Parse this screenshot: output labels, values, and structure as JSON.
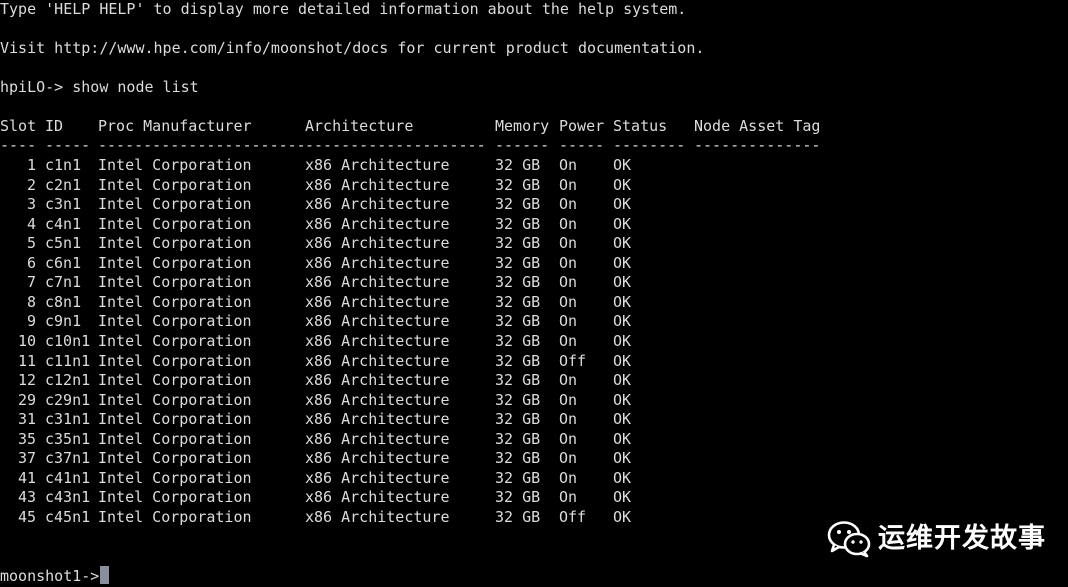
{
  "colors": {
    "background": "#000000",
    "text": "#dcdcdc",
    "cursor": "#8a9099",
    "watermark": "#ffffff"
  },
  "terminal": {
    "help_line": "Type 'HELP HELP' to display more detailed information about the help system.",
    "visit_line": "Visit http://www.hpe.com/info/moonshot/docs for current product documentation.",
    "command_prompt": "hpiLO-> ",
    "command": "show node list",
    "table": {
      "headers": {
        "slot": "Slot",
        "id": "ID",
        "manufacturer": "Proc Manufacturer",
        "architecture": "Architecture",
        "memory": "Memory",
        "power": "Power",
        "status": "Status",
        "asset_tag": "Node Asset Tag"
      },
      "separators": {
        "slot": "----",
        "id": "-----",
        "manufacturer": "-----------------------",
        "architecture": "--------------------",
        "memory": "------",
        "power": "-----",
        "status": "--------",
        "asset_tag": "--------------"
      },
      "rows": [
        {
          "slot": "1",
          "id": "c1n1",
          "manufacturer": "Intel Corporation",
          "architecture": "x86 Architecture",
          "memory": "32 GB",
          "power": "On",
          "status": "OK",
          "asset_tag": ""
        },
        {
          "slot": "2",
          "id": "c2n1",
          "manufacturer": "Intel Corporation",
          "architecture": "x86 Architecture",
          "memory": "32 GB",
          "power": "On",
          "status": "OK",
          "asset_tag": ""
        },
        {
          "slot": "3",
          "id": "c3n1",
          "manufacturer": "Intel Corporation",
          "architecture": "x86 Architecture",
          "memory": "32 GB",
          "power": "On",
          "status": "OK",
          "asset_tag": ""
        },
        {
          "slot": "4",
          "id": "c4n1",
          "manufacturer": "Intel Corporation",
          "architecture": "x86 Architecture",
          "memory": "32 GB",
          "power": "On",
          "status": "OK",
          "asset_tag": ""
        },
        {
          "slot": "5",
          "id": "c5n1",
          "manufacturer": "Intel Corporation",
          "architecture": "x86 Architecture",
          "memory": "32 GB",
          "power": "On",
          "status": "OK",
          "asset_tag": ""
        },
        {
          "slot": "6",
          "id": "c6n1",
          "manufacturer": "Intel Corporation",
          "architecture": "x86 Architecture",
          "memory": "32 GB",
          "power": "On",
          "status": "OK",
          "asset_tag": ""
        },
        {
          "slot": "7",
          "id": "c7n1",
          "manufacturer": "Intel Corporation",
          "architecture": "x86 Architecture",
          "memory": "32 GB",
          "power": "On",
          "status": "OK",
          "asset_tag": ""
        },
        {
          "slot": "8",
          "id": "c8n1",
          "manufacturer": "Intel Corporation",
          "architecture": "x86 Architecture",
          "memory": "32 GB",
          "power": "On",
          "status": "OK",
          "asset_tag": ""
        },
        {
          "slot": "9",
          "id": "c9n1",
          "manufacturer": "Intel Corporation",
          "architecture": "x86 Architecture",
          "memory": "32 GB",
          "power": "On",
          "status": "OK",
          "asset_tag": ""
        },
        {
          "slot": "10",
          "id": "c10n1",
          "manufacturer": "Intel Corporation",
          "architecture": "x86 Architecture",
          "memory": "32 GB",
          "power": "On",
          "status": "OK",
          "asset_tag": ""
        },
        {
          "slot": "11",
          "id": "c11n1",
          "manufacturer": "Intel Corporation",
          "architecture": "x86 Architecture",
          "memory": "32 GB",
          "power": "Off",
          "status": "OK",
          "asset_tag": ""
        },
        {
          "slot": "12",
          "id": "c12n1",
          "manufacturer": "Intel Corporation",
          "architecture": "x86 Architecture",
          "memory": "32 GB",
          "power": "On",
          "status": "OK",
          "asset_tag": ""
        },
        {
          "slot": "29",
          "id": "c29n1",
          "manufacturer": "Intel Corporation",
          "architecture": "x86 Architecture",
          "memory": "32 GB",
          "power": "On",
          "status": "OK",
          "asset_tag": ""
        },
        {
          "slot": "31",
          "id": "c31n1",
          "manufacturer": "Intel Corporation",
          "architecture": "x86 Architecture",
          "memory": "32 GB",
          "power": "On",
          "status": "OK",
          "asset_tag": ""
        },
        {
          "slot": "35",
          "id": "c35n1",
          "manufacturer": "Intel Corporation",
          "architecture": "x86 Architecture",
          "memory": "32 GB",
          "power": "On",
          "status": "OK",
          "asset_tag": ""
        },
        {
          "slot": "37",
          "id": "c37n1",
          "manufacturer": "Intel Corporation",
          "architecture": "x86 Architecture",
          "memory": "32 GB",
          "power": "On",
          "status": "OK",
          "asset_tag": ""
        },
        {
          "slot": "41",
          "id": "c41n1",
          "manufacturer": "Intel Corporation",
          "architecture": "x86 Architecture",
          "memory": "32 GB",
          "power": "On",
          "status": "OK",
          "asset_tag": ""
        },
        {
          "slot": "43",
          "id": "c43n1",
          "manufacturer": "Intel Corporation",
          "architecture": "x86 Architecture",
          "memory": "32 GB",
          "power": "On",
          "status": "OK",
          "asset_tag": ""
        },
        {
          "slot": "45",
          "id": "c45n1",
          "manufacturer": "Intel Corporation",
          "architecture": "x86 Architecture",
          "memory": "32 GB",
          "power": "Off",
          "status": "OK",
          "asset_tag": ""
        }
      ]
    },
    "final_prompt": "moonshot1->"
  },
  "watermark": {
    "icon": "wechat-icon",
    "text": "运维开发故事"
  }
}
